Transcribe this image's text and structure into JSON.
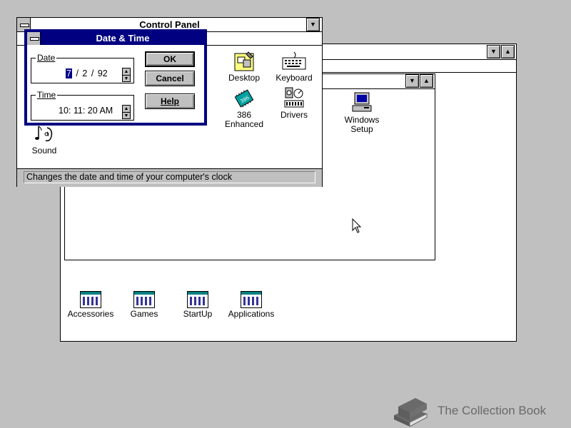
{
  "control_panel": {
    "title": "Control Panel",
    "icons": [
      {
        "label": "Desktop",
        "icon": "desktop-icon"
      },
      {
        "label": "Keyboard",
        "icon": "keyboard-icon"
      },
      {
        "label": "386 Enhanced",
        "icon": "chip-386-icon"
      },
      {
        "label": "Drivers",
        "icon": "drivers-icon"
      },
      {
        "label": "Sound",
        "icon": "sound-icon"
      }
    ],
    "status_text": "Changes the date and time of your computer's clock"
  },
  "date_time_dialog": {
    "title": "Date & Time",
    "date_label": "Date",
    "date_month": "7",
    "date_sep1": "/",
    "date_day": "2",
    "date_sep2": "/",
    "date_year": "92",
    "time_label": "Time",
    "time_value": "10: 11: 20 AM",
    "ok_label": "OK",
    "cancel_label": "Cancel",
    "help_label": "Help"
  },
  "main_group": {
    "setup_icon": {
      "label_line1": "Windows",
      "label_line2": "Setup",
      "icon": "windows-setup-icon"
    }
  },
  "program_manager": {
    "groups": [
      {
        "label": "Accessories",
        "icon": "program-group-icon"
      },
      {
        "label": "Games",
        "icon": "program-group-icon"
      },
      {
        "label": "StartUp",
        "icon": "program-group-icon"
      },
      {
        "label": "Applications",
        "icon": "program-group-icon"
      }
    ]
  },
  "watermark": {
    "text": "The Collection Book",
    "icon": "book-icon"
  },
  "colors": {
    "desktop": "#c0c0c0",
    "active_title": "#000080",
    "button_face": "#c0c0c0",
    "text": "#000000"
  }
}
